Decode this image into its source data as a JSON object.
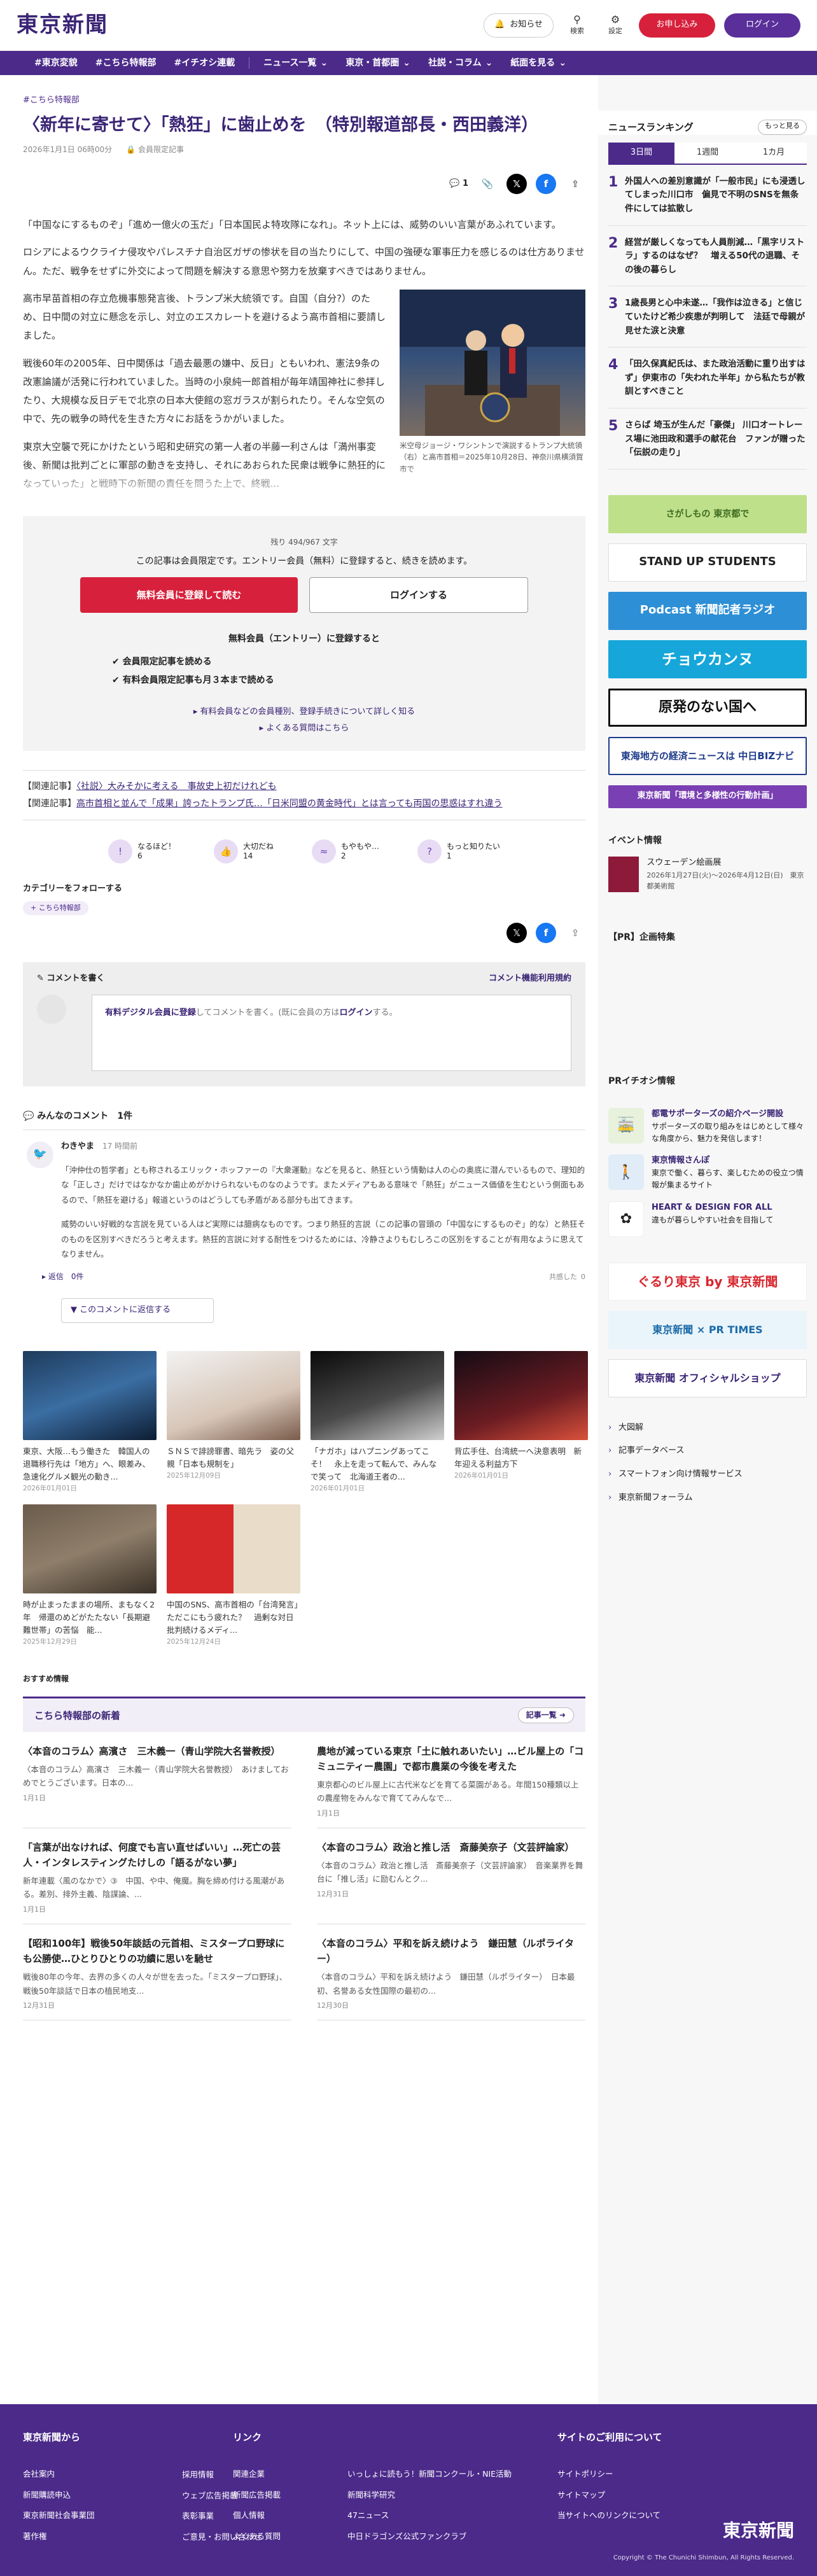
{
  "header": {
    "logo": "東京新聞",
    "notify": "お知らせ",
    "search": "検索",
    "settings": "設定",
    "register": "お申し込み",
    "login": "ログイン"
  },
  "nav": {
    "tags": [
      "#東京変貌",
      "#こちら特報部",
      "#イチオシ連載"
    ],
    "menus": [
      "ニュース一覧",
      "東京・首都圏",
      "社説・コラム",
      "紙面を見る"
    ]
  },
  "article": {
    "crumb": "こちら特報部",
    "title": "〈新年に寄せて〉「熱狂」に歯止めを　（特別報道部長・西田義洋）",
    "date": "2026年1月1日 06時00分",
    "member": "会員限定記事",
    "comments": "1",
    "paras": [
      "「中国なにするものぞ」「進め一億火の玉だ」「日本国民よ特攻隊になれ」。ネット上には、威勢のいい言葉があふれています。",
      "ロシアによるウクライナ侵攻やパレスチナ自治区ガザの惨状を目の当たりにして、中国の強硬な軍事圧力を感じるのは仕方ありません。ただ、戦争をせずに外交によって問題を解決する意思や努力を放棄すべきではありません。",
      "高市早苗首相の存立危機事態発言後、トランプ米大統領です。自国（自分?）のため、日中間の対立に懸念を示し、対立のエスカレートを避けるよう高市首相に要請しました。",
      "戦後60年の2005年、日中関係は「過去最悪の嫌中、反日」ともいわれ、憲法9条の改憲論議が活発に行われていました。当時の小泉純一郎首相が毎年靖国神社に参拝したり、大規模な反日デモで北京の日本大使館の窓ガラスが割られたり。そんな空気の中で、先の戦争の時代を生きた方々にお話をうかがいました。",
      "東京大空襲で死にかけたという昭和史研究の第一人者の半藤一利さんは「満州事変後、新聞は批判ごとに軍部の動きを支持し、それにあおられた民衆は戦争に熱狂的になっていった」と戦時下の新聞の責任を問うた上で、終戦..."
    ],
    "figure_caption": "米空母ジョージ・ワシントンで演説するトランプ大統領（右）と高市首相＝2025年10月28日、神奈川県横須賀市で"
  },
  "paywall": {
    "remaining": "残り 494/967 文字",
    "message": "この記事は会員限定です。エントリー会員（無料）に登録すると、続きを読めます。",
    "register": "無料会員に登録して読む",
    "login": "ログインする",
    "free_head": "無料会員（エントリー）に登録すると",
    "benefits": [
      "会員限定記事を読める",
      "有料会員限定記事も月３本まで読める"
    ],
    "links": [
      "有料会員などの会員種別、登録手続きについて詳しく知る",
      "よくある質問はこちら"
    ]
  },
  "related": [
    {
      "label": "【関連記事】",
      "text": "〈社説〉大みそかに考える　事故史上初だけれども"
    },
    {
      "label": "【関連記事】",
      "text": "高市首相と並んで「成果」誇ったトランプ氏…「日米同盟の黄金時代」とは言っても両国の思惑はすれ違う"
    }
  ],
  "reactions": [
    {
      "label": "なるほど！",
      "count": "6"
    },
    {
      "label": "大切だね",
      "count": "14"
    },
    {
      "label": "もやもや…",
      "count": "2"
    },
    {
      "label": "もっと知りたい",
      "count": "1"
    }
  ],
  "follow": {
    "label": "カテゴリーをフォローする",
    "chip": "こちら特報部"
  },
  "comment_box": {
    "title": "コメントを書く",
    "guide": "コメント機能利用規約",
    "prompt_link": "有料デジタル会員に登録",
    "prompt_text": "してコメントを書く。(既に会員の方は",
    "prompt_login": "ログイン",
    "prompt_end": "する。"
  },
  "comments": {
    "heading": "みんなのコメント",
    "count": "1件",
    "items": [
      {
        "user": "わきやま",
        "time": "17 時間前",
        "text1": "「沖仲仕の哲学者」とも称されるエリック・ホッファーの『大衆運動』などを見ると、熱狂という情動は人の心の奥底に潜んでいるもので、理知的な「正しさ」だけではなかなか歯止めがかけられないものなのようです。またメディアもある意味で「熱狂」がニュース価値を生むという側面もあるので、「熱狂を避ける」報道というのはどうしても矛盾がある部分も出てきます。",
        "text2": "威勢のいい好戦的な言説を見ている人はど実際には臆病なものです。つまり熱狂的言説（この記事の冒頭の「中国なにするものぞ」的な）と熱狂そのものを区別すべきだろうと考えます。熱狂的言説に対する耐性をつけるためには、冷静さよりもむしろこの区別をすることが有用なように思えてなりません。",
        "reply": "返信　0件",
        "like": "共感した",
        "likes": "0",
        "reply_toggle": "このコメントに返信する"
      }
    ]
  },
  "cards": [
    {
      "title": "東京、大阪…もう働きた　韓国人の退職移行先は「地方」へ、眼差み、急速化グルメ観光の動き...",
      "date": "2026年01月01日"
    },
    {
      "title": "ＳＮＳで誹謗罪書、暗先ラ　姿の父親「日本も規制を」",
      "date": "2025年12月09日"
    },
    {
      "title": "「ナガホ」はハプニングあってこそ！　永上を走って転んで、みんなで笑って　北海道王者の...",
      "date": "2026年01月01日"
    },
    {
      "title": "背広手住、台湾統一へ決意表明　新年迎える利益方下",
      "date": "2026年01月01日"
    },
    {
      "title": "時が止まったままの場所、まもなく2年　帰還のめどがたたない「長期避難世帯」の苦悩　能...",
      "date": "2025年12月29日"
    },
    {
      "title": "中国のSNS、高市首相の「台湾発言」ただこにもう疲れた？　過剰な対日批判続けるメディ...",
      "date": "2025年12月24日"
    }
  ],
  "rec_label": "おすすめ情報",
  "news": {
    "title": "こちら特報部の新着",
    "more": "記事一覧",
    "items": [
      {
        "h": "〈本音のコラム〉高濱さ　三木義一（青山学院大名誉教授）",
        "s": "〈本音のコラム〉高濱さ　三木義一（青山学院大名誉教授）　あけましておめでとうございます。日本の...",
        "d": "1月1日"
      },
      {
        "h": "農地が減っている東京「土に触れあいたい」…ビル屋上の「コミュニティー農園」で都市農業の今後を考えた",
        "s": "東京都心のビル屋上に古代米などを育てる菜園がある。年間150種類以上の農産物をみんなで育ててみんなで...",
        "d": "1月1日"
      },
      {
        "h": "「言葉が出なければ、何度でも言い直せばいい」…死亡の芸人・インタレスティングたけしの「語るがない夢」",
        "s": "新年連載〈風のなかで〉③　中国、や中、俺魔。胸を締め付ける風潮がある。差別、排外主義、陰謀論、...",
        "d": "1月1日"
      },
      {
        "h": "〈本音のコラム〉政治と推し活　斎藤美奈子（文芸評論家）",
        "s": "〈本音のコラム〉政治と推し活　斎藤美奈子（文芸評論家）　音楽業界を舞台に「推し活」に励むんとク...",
        "d": "12月31日"
      },
      {
        "h": "【昭和100年】戦後50年談話の元首相、ミスタープロ野球にも公勝使…ひとりひとりの功績に思いを馳せ",
        "s": "戦後80年の今年、去界の多くの人々が世を去った。「ミスタープロ野球」、戦後50年談話で日本の植民地支...",
        "d": "12月31日"
      },
      {
        "h": "〈本音のコラム〉平和を訴え続けよう　鎌田慧（ルポライター）",
        "s": "〈本音のコラム〉平和を訴え続けよう　鎌田慧（ルポライター）　日本最初、名誉ある女性国際の最初の...",
        "d": "12月30日"
      }
    ]
  },
  "ranking": {
    "title": "ニュースランキング",
    "more": "もっと見る",
    "tabs": [
      "3日間",
      "1週間",
      "1カ月"
    ],
    "items": [
      "外国人への差別意識が「一般市民」にも浸透してしまった川口市　偏見で不明のSNSを無条件にしては拡散し",
      "経営が厳しくなっても人員削減…「黒字リストラ」するのはなぜ？　増える50代の退職、その後の暮らし",
      "1歳長男と心中未遂…「我作は泣きる」と信じていたけど希少疾患が判明して　法廷で母親が見せた涙と決意",
      "「田久保真紀氏は、また政治活動に重り出すはず」伊東市の「失われた半年」から私たちが教訓とすべきこと",
      "さらば 埼玉が生んだ「豪傑」 川口オートレース場に池田政和選手の献花台　ファンが贈った「伝説の走り」"
    ]
  },
  "banners": [
    "さがしもの 東京都で",
    "STAND UP STUDENTS",
    "Podcast 新聞記者ラジオ",
    "チョウカンヌ",
    "原発のない国へ",
    "東海地方の経済ニュースは 中日BIZナビ",
    "東京新聞「環境と多様性の行動計画」"
  ],
  "event": {
    "heading": "イベント情報",
    "title": "スウェーデン絵画展",
    "date": "2026年1月27日(火)～2026年4月12日(日)　東京都美術館"
  },
  "pr_head": "【PR】企画特集",
  "pri_head": "PRイチオシ情報",
  "pri": [
    {
      "t": "都電サポーターズの紹介ページ開設",
      "s": "サポーターズの取り組みをはじめとして様々な角度から、魅力を発信します！"
    },
    {
      "t": "東京情報さんぽ",
      "s": "東京で働く、暮らす、楽しむための役立つ情報が集まるサイト"
    },
    {
      "t": "HEART & DESIGN FOR ALL",
      "s": "違もが暮らしやすい社会を目指して"
    }
  ],
  "side_banners": [
    "ぐるり東京 by 東京新聞",
    "東京新聞 × PR TIMES",
    "東京新聞 オフィシャルショップ"
  ],
  "side_links": [
    "大図解",
    "記事データベース",
    "スマートフォン向け情報サービス",
    "東京新聞フォーラム"
  ],
  "footer": {
    "col1": {
      "h": "東京新聞から",
      "l": [
        "会社案内",
        "新聞購読申込",
        "東京新聞社会事業団",
        "著作権"
      ]
    },
    "col2": {
      "h": "",
      "l": [
        "採用情報",
        "ウェブ広告掲載",
        "表彰事業",
        "ご意見・お問い合わせ"
      ]
    },
    "col3": {
      "h": "リンク",
      "l": [
        "関連企業",
        "新聞広告掲載",
        "個人情報",
        "よくある質問"
      ]
    },
    "col4": {
      "h": "",
      "l": [
        "いっしょに読もう！新聞コンクール・NIE活動",
        "新聞科学研究",
        "47ニュース",
        "中日ドラゴンズ公式ファンクラブ"
      ]
    },
    "col5": {
      "h": "サイトのご利用について",
      "l": [
        "サイトポリシー",
        "サイトマップ",
        "当サイトへのリンクについて"
      ]
    },
    "logo": "東京新聞",
    "copy": "Copyright © The Chunichi Shimbun, All Rights Reserved."
  }
}
